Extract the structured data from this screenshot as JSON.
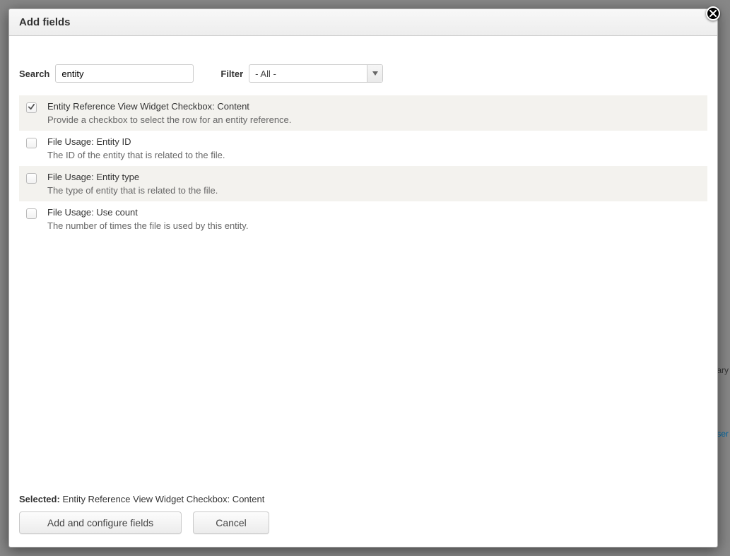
{
  "dialog": {
    "title": "Add fields"
  },
  "controls": {
    "search_label": "Search",
    "search_value": "entity",
    "filter_label": "Filter",
    "filter_value": "- All -"
  },
  "fields": [
    {
      "checked": true,
      "title": "Entity Reference View Widget Checkbox: Content",
      "desc": "Provide a checkbox to select the row for an entity reference."
    },
    {
      "checked": false,
      "title": "File Usage: Entity ID",
      "desc": "The ID of the entity that is related to the file."
    },
    {
      "checked": false,
      "title": "File Usage: Entity type",
      "desc": "The type of entity that is related to the file."
    },
    {
      "checked": false,
      "title": "File Usage: Use count",
      "desc": "The number of times the file is used by this entity."
    }
  ],
  "footer": {
    "selected_label": "Selected:",
    "selected_value": "Entity Reference View Widget Checkbox: Content",
    "primary_button": "Add and configure fields",
    "cancel_button": "Cancel"
  },
  "bg_hints": {
    "mary": "mary",
    "user": "user"
  }
}
